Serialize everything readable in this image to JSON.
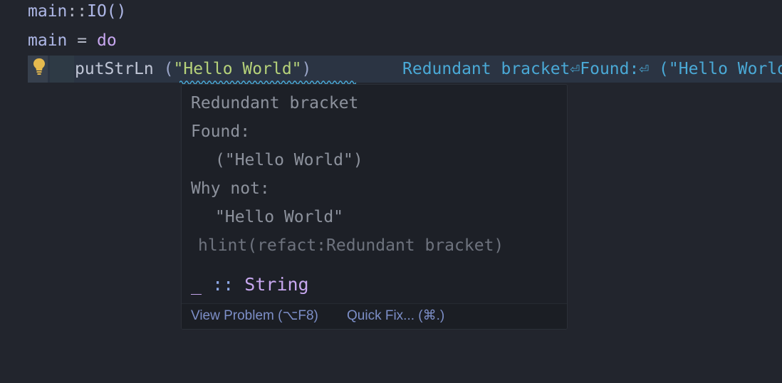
{
  "editor": {
    "lines": [
      {
        "main": "main",
        "op": "::",
        "type": "IO()"
      },
      {
        "main": "main",
        "eq": "=",
        "kw": "do"
      },
      {
        "fn": "putStrLn",
        "open_paren": "(",
        "string": "\"Hello World\"",
        "close_paren": ")"
      }
    ],
    "inline_diagnostic": "Redundant bracket⏎Found:⏎ (\"Hello World\")",
    "lightbulb_icon": "lightbulb-icon"
  },
  "hover": {
    "title": "Redundant bracket",
    "found_label": "Found:",
    "found_code": "(\"Hello World\")",
    "why_not_label": "Why not:",
    "why_not_code": "\"Hello World\"",
    "source": "hlint(refact:Redundant bracket)",
    "type_signature": {
      "name": "_",
      "op": "::",
      "type": "String"
    },
    "actions": {
      "view_problem": "View Problem (⌥F8)",
      "quick_fix": "Quick Fix... (⌘.)"
    }
  },
  "colors": {
    "background": "#22252d",
    "current_line": "#2b3443",
    "diagnostic_text": "#4aa9d6",
    "string": "#b6d27a",
    "keyword": "#c7a7ef",
    "hover_bg": "#1d2027",
    "link": "#7d8fc8"
  }
}
